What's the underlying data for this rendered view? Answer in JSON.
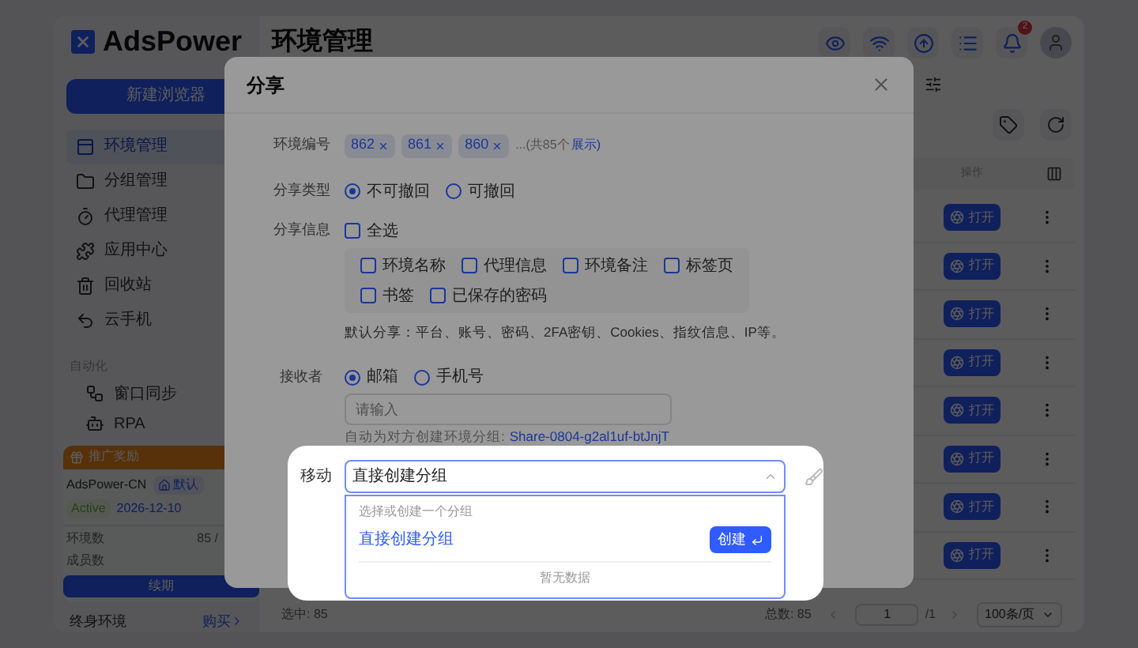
{
  "app": {
    "logo": "AdsPower",
    "page_title": "环境管理",
    "notification_count": "2"
  },
  "sidebar": {
    "new_button": "新建浏览器",
    "nav": [
      {
        "label": "环境管理",
        "selected": true
      },
      {
        "label": "分组管理",
        "selected": false
      },
      {
        "label": "代理管理",
        "selected": false
      },
      {
        "label": "应用中心",
        "selected": false
      },
      {
        "label": "回收站",
        "selected": false
      },
      {
        "label": "云手机",
        "selected": false
      }
    ],
    "section": "自动化",
    "automation": [
      {
        "label": "窗口同步",
        "selected": false
      },
      {
        "label": "RPA",
        "selected": false
      }
    ],
    "promo": {
      "header": "推广奖励",
      "team": "AdsPower-CN",
      "team_tag": "默认",
      "status": "Active",
      "expiry": "2026-12-10",
      "stats": [
        {
          "label": "环境数",
          "value": "85 /"
        },
        {
          "label": "成员数"
        }
      ],
      "renew_button": "续期"
    },
    "footer_label": "终身环境",
    "footer_link": "购买"
  },
  "table": {
    "action_header": "操作",
    "rows": [
      {
        "open_button": "打开"
      },
      {
        "open_button": "打开"
      },
      {
        "open_button": "打开"
      },
      {
        "open_button": "打开"
      },
      {
        "open_button": "打开"
      },
      {
        "open_button": "打开"
      },
      {
        "open_button": "打开"
      },
      {
        "open_button": "打开"
      }
    ]
  },
  "footer": {
    "selected": "选中: 85",
    "total": "总数: 85",
    "page": "1",
    "pages": "/1",
    "page_size": "100条/页"
  },
  "dialog": {
    "title": "分享",
    "ids_label": "环境编号",
    "ids": [
      "862",
      "861",
      "860"
    ],
    "ids_more": "...(共85个",
    "ids_more_link": "展示)",
    "type_label": "分享类型",
    "types": [
      {
        "label": "不可撤回",
        "selected": true
      },
      {
        "label": "可撤回",
        "selected": false
      }
    ],
    "info_label": "分享信息",
    "select_all": {
      "label": "全选",
      "checked": false
    },
    "info_options": [
      {
        "label": "环境名称",
        "checked": false
      },
      {
        "label": "代理信息",
        "checked": false
      },
      {
        "label": "环境备注",
        "checked": false
      },
      {
        "label": "标签页",
        "checked": false
      },
      {
        "label": "书签",
        "checked": false
      },
      {
        "label": "已保存的密码",
        "checked": false
      }
    ],
    "default_note": "默认分享：平台、账号、密码、2FA密钥、Cookies、指纹信息、IP等。",
    "receiver_label": "接收者",
    "receivers": [
      {
        "label": "邮箱",
        "selected": true
      },
      {
        "label": "手机号",
        "selected": false
      }
    ],
    "receiver_placeholder": "请输入",
    "group_hint": "自动为对方创建环境分组:",
    "group_name": "Share-0804-g2al1uf-btJnjT"
  },
  "spotlight": {
    "label": "移动",
    "value": "直接创建分组",
    "dropdown_hint": "选择或创建一个分组",
    "create_option": "直接创建分组",
    "create_button": "创建",
    "empty": "暂无数据"
  }
}
